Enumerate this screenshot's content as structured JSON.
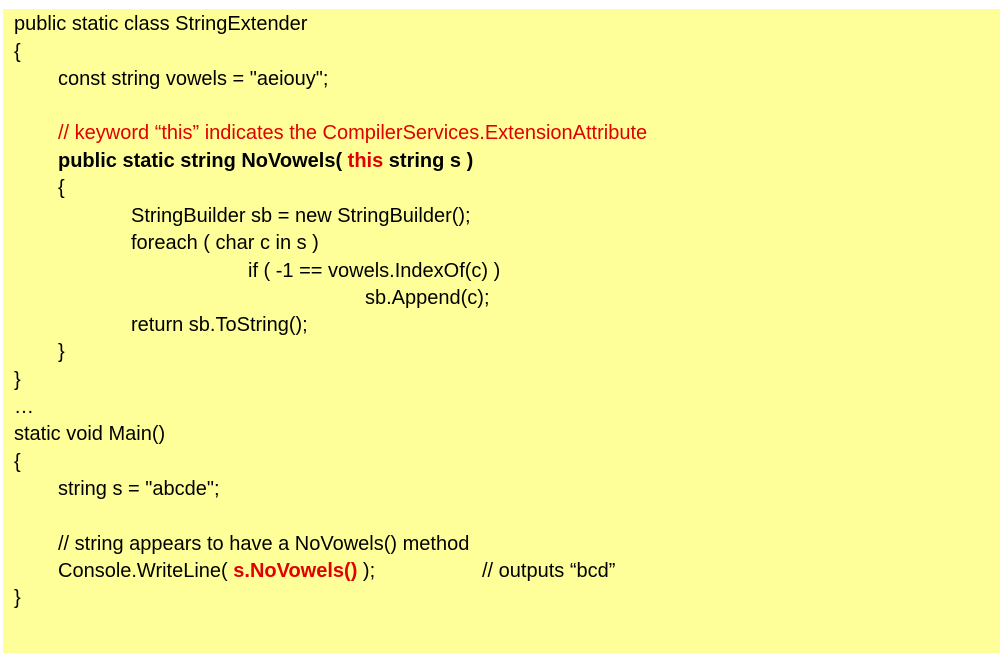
{
  "colors": {
    "background": "#ffff99",
    "text": "#000000",
    "highlight": "#e00000"
  },
  "code": {
    "l01": "public static class StringExtender",
    "l02": "{",
    "l03": "const string vowels = \"aeiouy\";",
    "l05": "// keyword “this” indicates the CompilerServices.ExtensionAttribute",
    "l06a": "public static string NoVowels( ",
    "l06b": "this",
    "l06c": " string s )",
    "l07": "{",
    "l08": "StringBuilder sb = new StringBuilder();",
    "l09": "foreach ( char c in s )",
    "l10": "if ( -1 == vowels.IndexOf(c) )",
    "l11": "sb.Append(c);",
    "l12": "return sb.ToString();",
    "l13": "}",
    "l14": "}",
    "l15": "…",
    "l16": "static void Main()",
    "l17": "{",
    "l18": "string s = \"abcde\";",
    "l20": "// string appears to have a NoVowels() method",
    "l21a": "Console.WriteLine( ",
    "l21b": "s.NoVowels()",
    "l21c": " );",
    "l21d": "// outputs “bcd”",
    "l22": "}"
  }
}
